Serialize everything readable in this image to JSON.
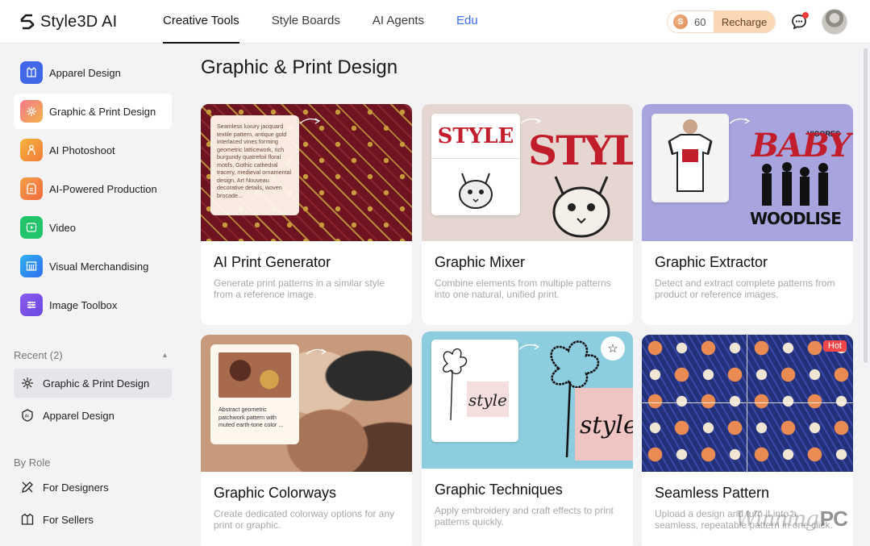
{
  "header": {
    "brand": "Style3D AI",
    "nav": [
      {
        "label": "Creative Tools",
        "active": true
      },
      {
        "label": "Style Boards",
        "active": false
      },
      {
        "label": "AI Agents",
        "active": false
      },
      {
        "label": "Edu",
        "active": false
      }
    ],
    "credits": "60",
    "recharge_label": "Recharge"
  },
  "sidebar": {
    "items": [
      {
        "label": "Apparel Design",
        "icon": "dress-icon",
        "color": "#3f67e8"
      },
      {
        "label": "Graphic & Print Design",
        "icon": "print-icon",
        "color": "#f2607a"
      },
      {
        "label": "AI Photoshoot",
        "icon": "model-icon",
        "color": "#f59a3c"
      },
      {
        "label": "AI-Powered Production",
        "icon": "production-icon",
        "color": "#f57a3c"
      },
      {
        "label": "Video",
        "icon": "video-icon",
        "color": "#22c46a"
      },
      {
        "label": "Visual Merchandising",
        "icon": "merch-icon",
        "color": "#2f8ef0"
      },
      {
        "label": "Image Toolbox",
        "icon": "toolbox-icon",
        "color": "#7a58e6"
      }
    ],
    "recent_heading": "Recent (2)",
    "recent": [
      {
        "label": "Graphic & Print Design"
      },
      {
        "label": "Apparel Design"
      }
    ],
    "role_heading": "By Role",
    "roles": [
      {
        "label": "For Designers"
      },
      {
        "label": "For Sellers"
      }
    ]
  },
  "main": {
    "title": "Graphic & Print Design",
    "cards": [
      {
        "title": "AI Print Generator",
        "desc": "Generate print patterns in a similar style from a reference image.",
        "thumb_text": "Seamless luxury jacquard textile pattern, antique gold interlaced vines forming geometric latticework, rich burgundy quatrefoil floral motifs, Gothic cathedral tracery, medieval ornamental design, Art Nouveau decorative details, woven brocade..."
      },
      {
        "title": "Graphic Mixer",
        "desc": "Combine elements from multiple patterns into one natural, unified print.",
        "thumb_text_1": "STYLE",
        "thumb_text_2": "STYLE"
      },
      {
        "title": "Graphic Extractor",
        "desc": "Detect and extract complete patterns from product or reference images.",
        "thumb_text_1": "BABY",
        "thumb_text_2": "WOODLISE",
        "thumb_text_3": "VIGORES"
      },
      {
        "title": "Graphic Colorways",
        "desc": "Create dedicated colorway options for any print or graphic.",
        "thumb_text": "Abstract geometric patchwork pattern with muted earth-tone color ..."
      },
      {
        "title": "Graphic Techniques",
        "desc": "Apply embroidery and craft effects to print patterns quickly.",
        "thumb_text": "style"
      },
      {
        "title": "Seamless Pattern",
        "desc": "Upload a design and turn it into a seamless, repeatable pattern in one click.",
        "badge": "Hot"
      }
    ]
  },
  "watermark": {
    "script": "Winning",
    "suffix": "PC"
  }
}
